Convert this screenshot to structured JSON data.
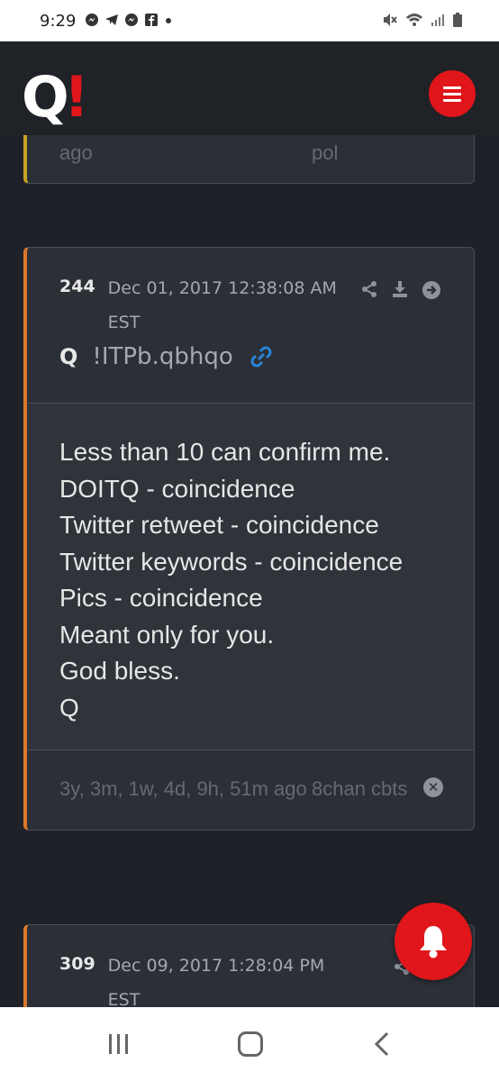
{
  "status_bar": {
    "time": "9:29",
    "notification_icons": [
      "messenger-icon",
      "telegram-icon",
      "messenger-icon",
      "facebook-icon",
      "dot-icon"
    ],
    "system_icons": [
      "mute-icon",
      "wifi-icon",
      "signal-icon",
      "battery-icon"
    ]
  },
  "header": {
    "logo_letter": "Q",
    "logo_mark": "!",
    "menu_icon": "hamburger-icon"
  },
  "colors": {
    "accent_red": "#e0161a",
    "card_yellow_border": "#c9a227",
    "card_orange_border": "#d9782c",
    "link_blue": "#2a84d8",
    "background": "#1e2228"
  },
  "posts": [
    {
      "footer_time": "ago",
      "footer_source": "pol"
    },
    {
      "number": "244",
      "date": "Dec 01, 2017 12:38:08 AM EST",
      "author": "Q",
      "tripcode": "!ITPb.qbhqo",
      "body": [
        "Less than 10 can confirm me.",
        "DOITQ - coincidence",
        "Twitter retweet - coincidence",
        "Twitter keywords - coincidence",
        "Pics - coincidence",
        "Meant only for you.",
        "God bless.",
        "Q"
      ],
      "footer_time": "3y, 3m, 1w, 4d, 9h, 51m ago",
      "footer_source": "8chan cbts"
    },
    {
      "number": "309",
      "date": "Dec 09, 2017 1:28:04 PM EST"
    }
  ],
  "fab": {
    "icon": "bell-icon"
  },
  "nav": {
    "recent": "recent-apps-icon",
    "home": "home-icon",
    "back": "back-icon"
  }
}
